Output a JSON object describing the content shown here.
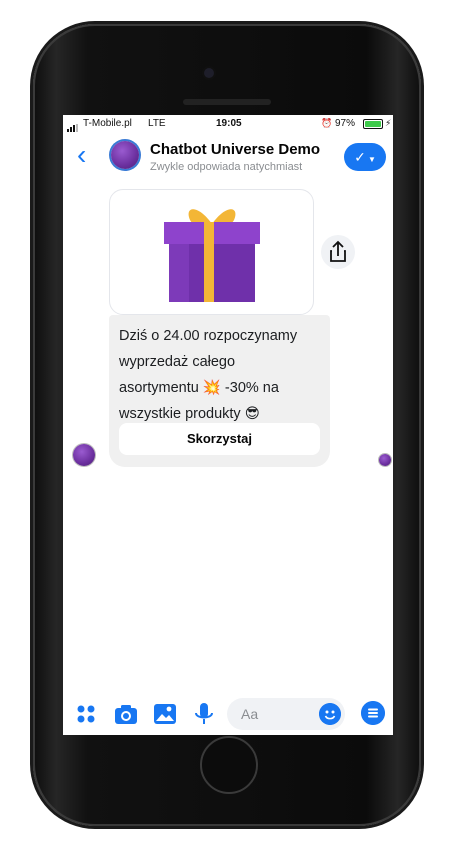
{
  "status_bar": {
    "carrier": "T-Mobile.pl",
    "network": "LTE",
    "time": "19:05",
    "battery": "97%",
    "battery_level": 0.97
  },
  "header": {
    "back_icon": "chevron-left-icon",
    "title": "Chatbot Universe Demo",
    "subtitle": "Zwykle odpowiada natychmiast",
    "action_icon": "check-dropdown-icon"
  },
  "message": {
    "image_icon": "gift-box-icon",
    "share_icon": "share-icon",
    "text_line1": "Dziś o 24.00 rozpoczynamy",
    "text_line2": "wyprzedaż całego",
    "text_line3a": "asortymentu",
    "text_line3b": "-30% na",
    "text_line4": "wszystkie produkty",
    "emoji_collision": "💥",
    "emoji_sunglasses": "😎",
    "button_label": "Skorzystaj"
  },
  "composer": {
    "placeholder": "Aa",
    "icons": [
      "apps-icon",
      "camera-icon",
      "image-icon",
      "microphone-icon",
      "emoji-icon",
      "menu-icon"
    ]
  },
  "colors": {
    "accent": "#1877f2",
    "bubble": "#f0f0f0",
    "gift_purple": "#7a35b8",
    "gift_ribbon": "#f3b636"
  }
}
